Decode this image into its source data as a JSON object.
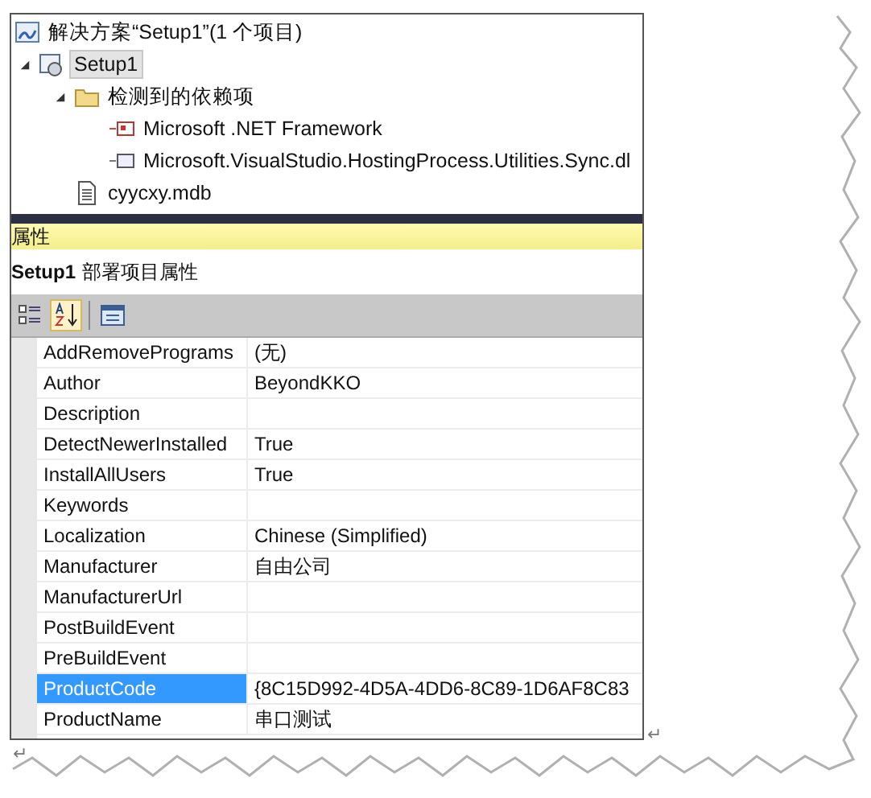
{
  "solution": {
    "title": "解决方案“Setup1”(1 个项目)",
    "tree": [
      {
        "label": "Setup1",
        "kind": "setup",
        "expanded": true,
        "selected": true,
        "children": [
          {
            "label": "检测到的依赖项",
            "kind": "folder",
            "expanded": true,
            "selected": false,
            "children": [
              {
                "label": "Microsoft .NET Framework",
                "kind": "framework",
                "selected": false
              },
              {
                "label": "Microsoft.VisualStudio.HostingProcess.Utilities.Sync.dl",
                "kind": "assembly",
                "selected": false
              }
            ]
          },
          {
            "label": "cyycxy.mdb",
            "kind": "file",
            "selected": false
          }
        ]
      }
    ]
  },
  "properties": {
    "title": "属性",
    "object": "Setup1",
    "object_desc": "部署项目属性",
    "toolbar": [
      {
        "kind": "categorized",
        "selected": false
      },
      {
        "kind": "alphabetical",
        "selected": true
      },
      {
        "kind": "pages",
        "selected": false
      }
    ],
    "rows": [
      {
        "name": "AddRemovePrograms",
        "value": "(无)",
        "selected": false
      },
      {
        "name": "Author",
        "value": "BeyondKKO",
        "selected": false
      },
      {
        "name": "Description",
        "selected": false
      },
      {
        "name": "DetectNewerInstalled",
        "value": "True",
        "selected": false
      },
      {
        "name": "InstallAllUsers",
        "value": "True",
        "selected": false
      },
      {
        "name": "Keywords",
        "selected": false
      },
      {
        "name": "Localization",
        "value": "Chinese (Simplified)",
        "selected": false
      },
      {
        "name": "Manufacturer",
        "value": "自由公司",
        "selected": false
      },
      {
        "name": "ManufacturerUrl",
        "selected": false
      },
      {
        "name": "PostBuildEvent",
        "selected": false
      },
      {
        "name": "PreBuildEvent",
        "selected": false
      },
      {
        "name": "ProductCode",
        "value": "{8C15D992-4D5A-4DD6-8C89-1D6AF8C83",
        "selected": true
      },
      {
        "name": "ProductName",
        "value": "串口测试",
        "selected": false
      }
    ]
  },
  "paragraph_marks": [
    "↵",
    "↵"
  ]
}
